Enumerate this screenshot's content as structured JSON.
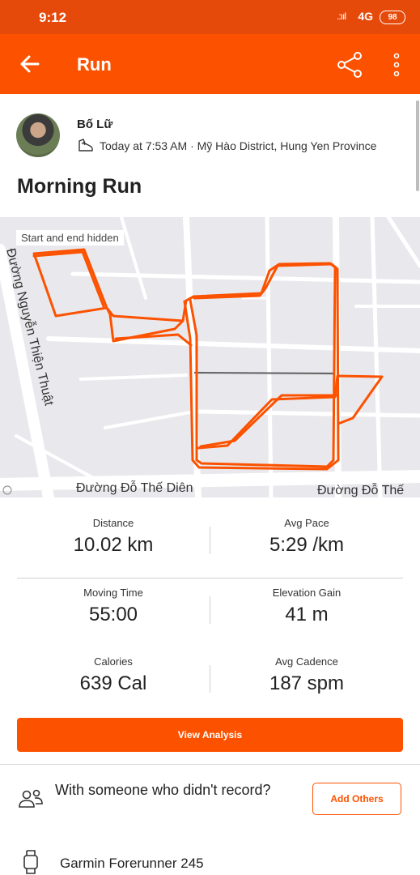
{
  "status_bar": {
    "time": "9:12",
    "signal": ".:ııl",
    "network": "4G",
    "battery": "98"
  },
  "app_bar": {
    "title": "Run",
    "back_icon": "arrow-left-icon",
    "share_icon": "share-icon",
    "more_icon": "more-vertical-icon"
  },
  "athlete": {
    "name": "Bố Lữ",
    "meta": "Today at 7:53 AM · Mỹ Hào District, Hung Yen Province"
  },
  "activity": {
    "title": "Morning Run"
  },
  "map": {
    "badge": "Start and end hidden",
    "street_vertical": "Đường Nguyễn Thiện Thuật",
    "street_bottom_left": "Đường Đỗ Thế Diên",
    "street_bottom_right": "Đường Đỗ Thế",
    "route_color": "#fc5200"
  },
  "stats": [
    {
      "label": "Distance",
      "value": "10.02 km"
    },
    {
      "label": "Avg Pace",
      "value": "5:29 /km"
    },
    {
      "label": "Moving Time",
      "value": "55:00"
    },
    {
      "label": "Elevation Gain",
      "value": "41 m"
    },
    {
      "label": "Calories",
      "value": "639 Cal"
    },
    {
      "label": "Avg Cadence",
      "value": "187 spm"
    }
  ],
  "buttons": {
    "view_analysis": "View Analysis",
    "add_others": "Add Others"
  },
  "others": {
    "text": "With someone who didn't record?"
  },
  "device": {
    "name": "Garmin Forerunner 245"
  },
  "colors": {
    "brand": "#fc5200",
    "status_bar": "#e64a0a"
  }
}
